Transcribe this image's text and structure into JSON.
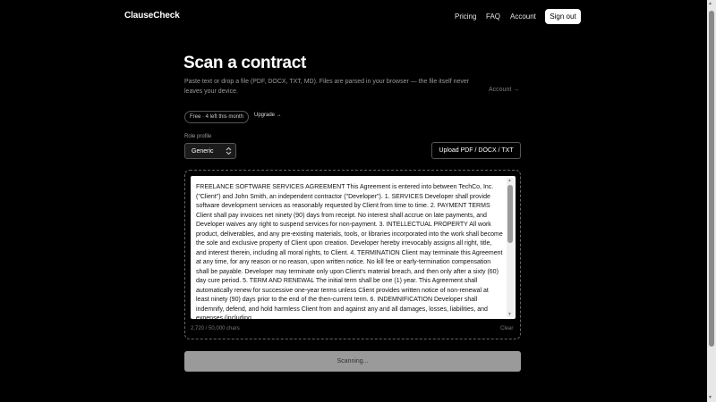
{
  "nav": {
    "brand": "ClauseCheck",
    "links": [
      "Pricing",
      "FAQ",
      "Account"
    ],
    "signout": "Sign out"
  },
  "main": {
    "title": "Scan a contract",
    "subtitle": "Paste text or drop a file (PDF, DOCX, TXT, MD). Files are parsed in your browser — the file itself never leaves your device.",
    "account_link": "Account →",
    "plan_badge": "Free · 4 left this month",
    "upgrade": "Upgrade →",
    "role_label": "Role profile",
    "role_selected": "Generic",
    "upload_button": "Upload PDF / DOCX / TXT",
    "contract_text": "FREELANCE SOFTWARE SERVICES AGREEMENT This Agreement is entered into between TechCo, Inc. (\"Client\") and John Smith, an independent contractor (\"Developer\"). 1. SERVICES Developer shall provide software development services as reasonably requested by Client from time to time. 2. PAYMENT TERMS Client shall pay invoices net ninety (90) days from receipt. No interest shall accrue on late payments, and Developer waives any right to suspend services for non-payment. 3. INTELLECTUAL PROPERTY All work product, deliverables, and any pre-existing materials, tools, or libraries incorporated into the work shall become the sole and exclusive property of Client upon creation. Developer hereby irrevocably assigns all right, title, and interest therein, including all moral rights, to Client. 4. TERMINATION Client may terminate this Agreement at any time, for any reason or no reason, upon written notice. No kill fee or early-termination compensation shall be payable. Developer may terminate only upon Client's material breach, and then only after a sixty (60) day cure period. 5. TERM AND RENEWAL The initial term shall be one (1) year. This Agreement shall automatically renew for successive one-year terms unless Client provides written notice of non-renewal at least ninety (90) days prior to the end of the then-current term. 6. INDEMNIFICATION Developer shall indemnify, defend, and hold harmless Client from and against any and all damages, losses, liabilities, and expenses (including",
    "char_count": "2,720 / 50,000 chars",
    "clear": "Clear",
    "scan_button": "Scanning..."
  },
  "icons": {
    "select_chevron": "chevron-updown-icon",
    "scroll_arrows": "triangle-arrow-icon"
  },
  "colors": {
    "background": "#000000",
    "primary_button": "#ffffff",
    "scan_button_disabled": "#9a9a9a"
  }
}
